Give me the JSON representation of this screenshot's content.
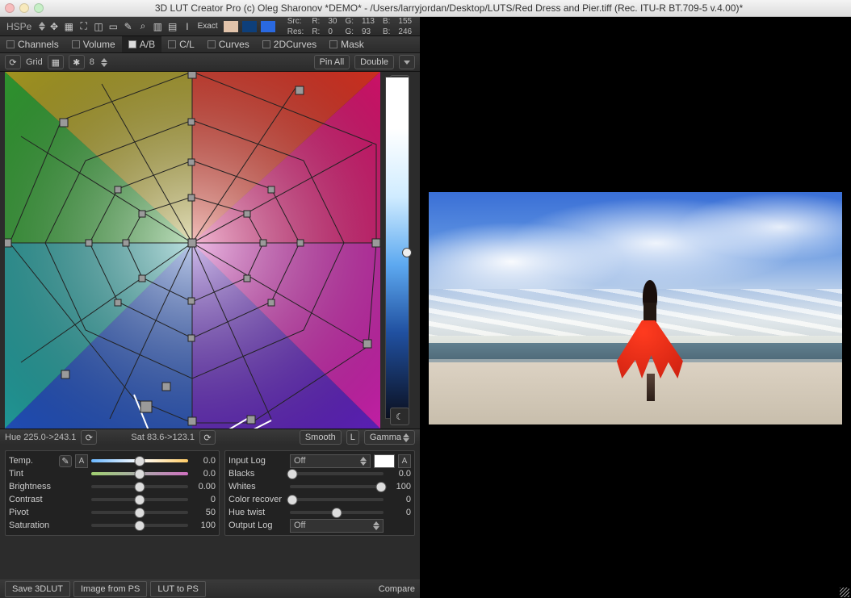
{
  "title": "3D LUT Creator Pro (c) Oleg Sharonov *DEMO* - /Users/larryjordan/Desktop/LUTS/Red Dress and Pier.tiff (Rec. ITU-R BT.709-5 v.4.00)*",
  "mode": "HSPe",
  "exact_label": "Exact",
  "swatches": [
    {
      "name": "swatch-skin",
      "color": "#e2c4ab"
    },
    {
      "name": "swatch-sky",
      "color": "#0e3f7a"
    },
    {
      "name": "swatch-blue",
      "color": "#2a69e0"
    }
  ],
  "readout": {
    "src": {
      "label": "Src:",
      "R": 30,
      "G": 113,
      "B": 155
    },
    "res": {
      "label": "Res:",
      "R": 0,
      "G": 93,
      "B": 246
    }
  },
  "tabs": [
    {
      "label": "Channels",
      "selected": false
    },
    {
      "label": "Volume",
      "selected": false
    },
    {
      "label": "A/B",
      "selected": true
    },
    {
      "label": "C/L",
      "selected": false
    },
    {
      "label": "Curves",
      "selected": false
    },
    {
      "label": "2DCurves",
      "selected": false
    },
    {
      "label": "Mask",
      "selected": false
    }
  ],
  "subbar": {
    "grid_label": "Grid",
    "grid_size": "8",
    "pin_all": "Pin All",
    "double": "Double"
  },
  "status": {
    "hue": "Hue 225.0->243.1",
    "sat": "Sat 83.6->123.1",
    "smooth": "Smooth",
    "L": "L",
    "gamma": "Gamma"
  },
  "left_sliders": {
    "temp": {
      "label": "Temp.",
      "value": "0.0",
      "pos": 50
    },
    "tint": {
      "label": "Tint",
      "value": "0.0",
      "pos": 50
    },
    "brightness": {
      "label": "Brightness",
      "value": "0.00",
      "pos": 50
    },
    "contrast": {
      "label": "Contrast",
      "value": "0",
      "pos": 50
    },
    "pivot": {
      "label": "Pivot",
      "value": "50",
      "pos": 50
    },
    "saturation": {
      "label": "Saturation",
      "value": "100",
      "pos": 50
    }
  },
  "right_sliders": {
    "input_log": {
      "label": "Input Log",
      "value": "Off"
    },
    "blacks": {
      "label": "Blacks",
      "value": "0.0",
      "pos": 3
    },
    "whites": {
      "label": "Whites",
      "value": "100",
      "pos": 97
    },
    "color_recover": {
      "label": "Color recover",
      "value": "0",
      "pos": 3
    },
    "hue_twist": {
      "label": "Hue twist",
      "value": "0",
      "pos": 50
    },
    "output_log": {
      "label": "Output Log",
      "value": "Off"
    }
  },
  "a_button": "A",
  "bottom": {
    "save": "Save 3DLUT",
    "from_ps": "Image from PS",
    "to_ps": "LUT to PS",
    "compare": "Compare"
  }
}
